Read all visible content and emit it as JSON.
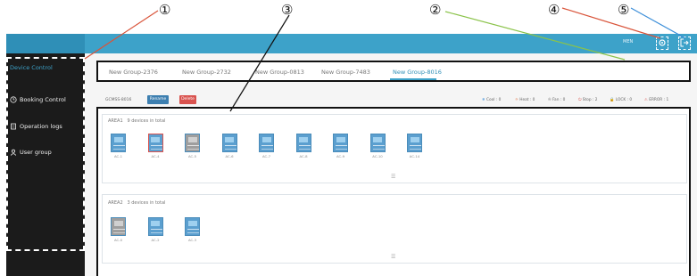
{
  "callouts": [
    "①",
    "②",
    "③",
    "④",
    "⑤"
  ],
  "header": {
    "user": "MEN"
  },
  "sidebar": {
    "items": [
      {
        "label": "Device Control",
        "icon": "device-icon"
      },
      {
        "label": "Booking Control",
        "icon": "clock-icon"
      },
      {
        "label": "Operation logs",
        "icon": "log-icon"
      },
      {
        "label": "User group",
        "icon": "user-icon"
      }
    ]
  },
  "tabs": [
    "New Group-2376",
    "New Group-2732",
    "New Group-0813",
    "New Group-7483",
    "New Group-8016"
  ],
  "active_tab": "New Group-8016",
  "toolbar": {
    "group_name": "GCMSS-8016",
    "rename_label": "Rename",
    "delete_label": "Delete",
    "legend": [
      "Cool : 0",
      "Heat : 0",
      "Fan : 0",
      "Stop : 2",
      "LOCK : 0",
      "ERROR : 1"
    ]
  },
  "areas": [
    {
      "name": "AREA1",
      "summary": "9 devices in total",
      "devices": [
        {
          "label": "AC-1",
          "state": "normal"
        },
        {
          "label": "AC-4",
          "state": "error"
        },
        {
          "label": "AC-5",
          "state": "stop"
        },
        {
          "label": "AC-6",
          "state": "normal"
        },
        {
          "label": "AC-7",
          "state": "normal"
        },
        {
          "label": "AC-8",
          "state": "normal"
        },
        {
          "label": "AC-9",
          "state": "normal"
        },
        {
          "label": "AC-10",
          "state": "normal"
        },
        {
          "label": "AC-14",
          "state": "normal"
        }
      ]
    },
    {
      "name": "AREA2",
      "summary": "3 devices in total",
      "devices": [
        {
          "label": "AC-0",
          "state": "stop"
        },
        {
          "label": "AC-2",
          "state": "normal"
        },
        {
          "label": "AC-3",
          "state": "normal"
        }
      ]
    }
  ],
  "colors": {
    "accent": "#3da2c9",
    "delete": "#d9534f",
    "device": "#5b9fcf",
    "stop": "#9e9e9e",
    "error_border": "#d9534f"
  }
}
